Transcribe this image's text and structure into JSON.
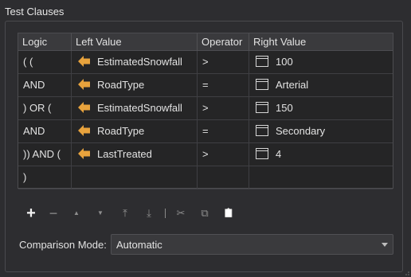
{
  "group": {
    "title": "Test Clauses"
  },
  "table": {
    "columns": [
      "Logic",
      "Left Value",
      "Operator",
      "Right Value"
    ],
    "rows": [
      {
        "logic": "( (",
        "left": "EstimatedSnowfall",
        "operator": ">",
        "right": "100"
      },
      {
        "logic": "AND",
        "left": "RoadType",
        "operator": "=",
        "right": "Arterial"
      },
      {
        "logic": ") OR (",
        "left": "EstimatedSnowfall",
        "operator": ">",
        "right": "150"
      },
      {
        "logic": "AND",
        "left": "RoadType",
        "operator": "=",
        "right": "Secondary"
      },
      {
        "logic": ")) AND (",
        "left": "LastTreated",
        "operator": ">",
        "right": "4"
      },
      {
        "logic": ")",
        "left": "",
        "operator": "",
        "right": ""
      }
    ]
  },
  "toolbar": {
    "add": "+",
    "remove": "−",
    "move_up": "▲",
    "move_down": "▼",
    "move_top": "⤒",
    "move_bottom": "⤓",
    "cut": "✂",
    "copy": "⧉",
    "paste": "📋"
  },
  "comparison": {
    "label": "Comparison Mode:",
    "value": "Automatic"
  },
  "colors": {
    "attribute_icon": "#e8a33d",
    "background": "#2d2d30",
    "table_bg": "#252526",
    "header_bg": "#3a3a3d"
  }
}
